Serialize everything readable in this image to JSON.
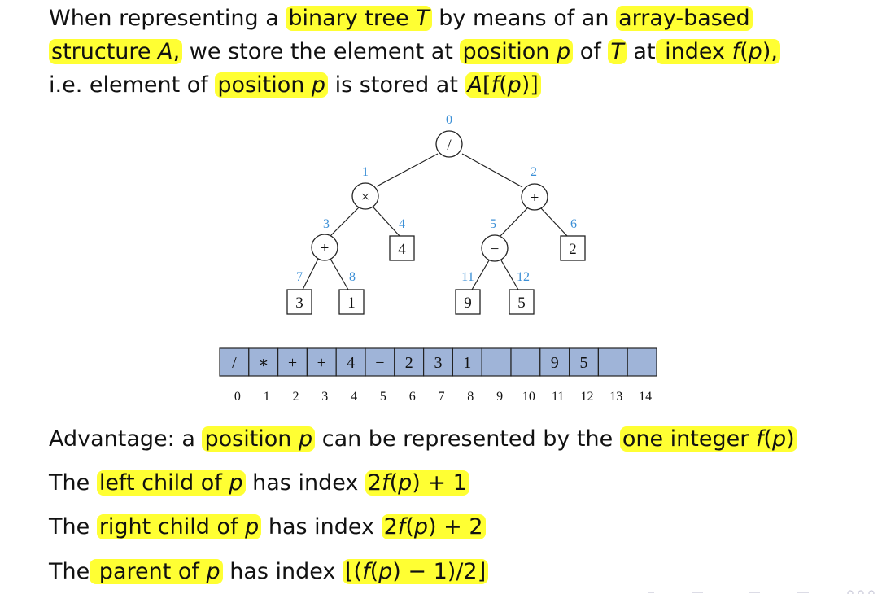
{
  "intro": {
    "t1": "When representing a ",
    "h1": "binary tree ",
    "m1": "T",
    "t2": " by means of an ",
    "h2": "array-based",
    "h3": "structure ",
    "m3": "A",
    "t3": ",",
    "t4": " we store the element at ",
    "h4": "position ",
    "m4": "p",
    "t5": " of ",
    "m5": "T",
    "t6": " at",
    "h6": " index ",
    "m6": "f",
    "t7": "(",
    "m7": "p",
    "t8": "),",
    "t9": "i.e. element of ",
    "h9": "position ",
    "m9": "p",
    "t10": " is stored at ",
    "m10": "A",
    "t11": "[",
    "m11": "f",
    "t12": "(",
    "m12": "p",
    "t13": ")]"
  },
  "tree": {
    "nodes": [
      {
        "index": "0",
        "label": "/",
        "shape": "circle"
      },
      {
        "index": "1",
        "label": "×",
        "shape": "circle"
      },
      {
        "index": "2",
        "label": "+",
        "shape": "circle"
      },
      {
        "index": "3",
        "label": "+",
        "shape": "circle"
      },
      {
        "index": "4",
        "label": "4",
        "shape": "square"
      },
      {
        "index": "5",
        "label": "−",
        "shape": "circle"
      },
      {
        "index": "6",
        "label": "2",
        "shape": "square"
      },
      {
        "index": "7",
        "label": "3",
        "shape": "square"
      },
      {
        "index": "8",
        "label": "1",
        "shape": "square"
      },
      {
        "index": "11",
        "label": "9",
        "shape": "square"
      },
      {
        "index": "12",
        "label": "5",
        "shape": "square"
      }
    ],
    "index_color": "#3b8fd6"
  },
  "array": {
    "cells": [
      "/",
      "∗",
      "+",
      "+",
      "4",
      "−",
      "2",
      "3",
      "1",
      "",
      "",
      "9",
      "5",
      "",
      ""
    ],
    "indices": [
      "0",
      "1",
      "2",
      "3",
      "4",
      "5",
      "6",
      "7",
      "8",
      "9",
      "10",
      "11",
      "12",
      "13",
      "14"
    ],
    "fill_color": "#9fb4d8"
  },
  "bullets": {
    "b1": {
      "t1": "Advantage: a ",
      "h1": "position ",
      "m1": "p",
      "t2": " can be represented by the ",
      "h2": "one integer ",
      "m2": "f",
      "t3": "(",
      "m3": "p",
      "t4": ")"
    },
    "b2": {
      "t1": "The ",
      "h1": "left child of ",
      "m1": "p",
      "t2": " has index ",
      "e1": "2",
      "m2": "f",
      "e2": "(",
      "m3": "p",
      "e3": ") + 1"
    },
    "b3": {
      "t1": "The ",
      "h1": "right child of ",
      "m1": "p",
      "t2": " has index ",
      "e1": "2",
      "m2": "f",
      "e2": "(",
      "m3": "p",
      "e3": ") + 2"
    },
    "b4": {
      "t1": "The",
      "h1": " parent of ",
      "m1": "p",
      "t2": " has index ",
      "e1": "⌊(",
      "m2": "f",
      "e2": "(",
      "m3": "p",
      "e3": ") − 1)/2⌋"
    }
  },
  "colors": {
    "highlight": "#ffff33",
    "text": "#111111"
  }
}
